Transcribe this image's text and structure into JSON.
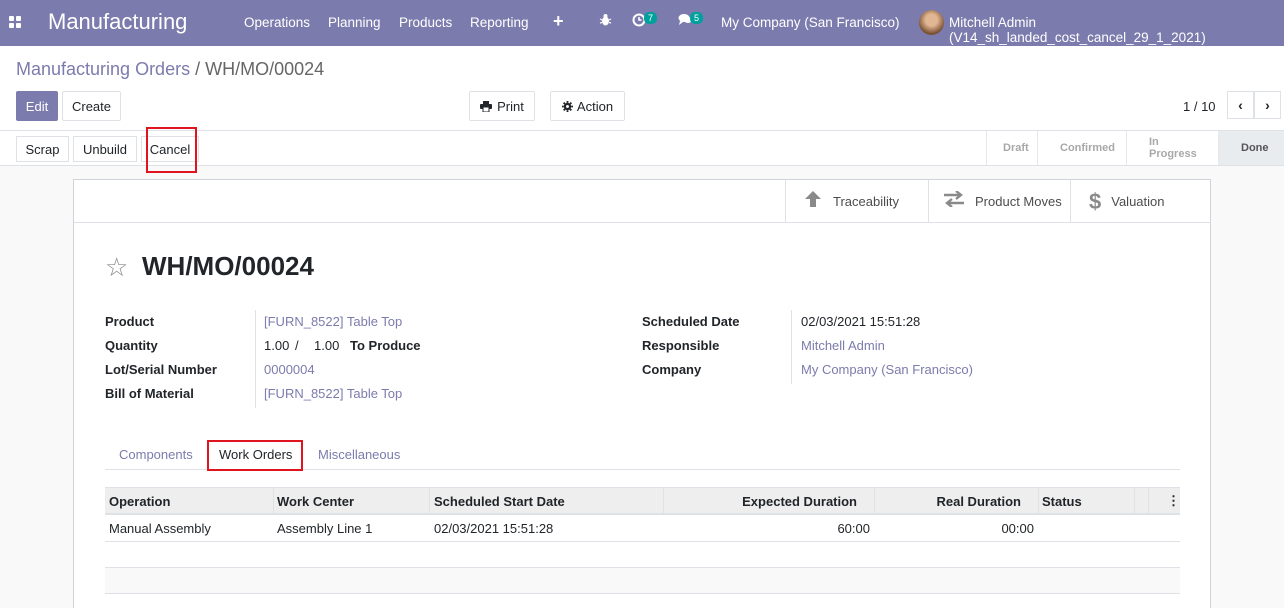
{
  "navbar": {
    "brand": "Manufacturing",
    "menu": [
      "Operations",
      "Planning",
      "Products",
      "Reporting"
    ],
    "activity_count": "7",
    "messages_count": "5",
    "company": "My Company (San Francisco)",
    "user": "Mitchell Admin (V14_sh_landed_cost_cancel_29_1_2021)"
  },
  "breadcrumb": {
    "parent": "Manufacturing Orders",
    "separator": "/",
    "current": "WH/MO/00024"
  },
  "toolbar": {
    "edit": "Edit",
    "create": "Create",
    "print": "Print",
    "action": "Action",
    "pager": "1 / 10"
  },
  "statusbar": {
    "buttons": [
      "Scrap",
      "Unbuild",
      "Cancel"
    ],
    "stages": [
      "Draft",
      "Confirmed",
      "In Progress",
      "Done"
    ],
    "active_stage": "Done"
  },
  "smart_buttons": [
    "Traceability",
    "Product Moves",
    "Valuation"
  ],
  "record": {
    "name": "WH/MO/00024",
    "left_fields": [
      {
        "label": "Product",
        "value": "[FURN_8522] Table Top"
      },
      {
        "label": "Quantity",
        "value": "1.00",
        "value2": "/",
        "value3": "1.00",
        "value4": "To Produce"
      },
      {
        "label": "Lot/Serial Number",
        "value": "0000004"
      },
      {
        "label": "Bill of Material",
        "value": "[FURN_8522] Table Top"
      }
    ],
    "right_fields": [
      {
        "label": "Scheduled Date",
        "value": "02/03/2021 15:51:28"
      },
      {
        "label": "Responsible",
        "value": "Mitchell Admin"
      },
      {
        "label": "Company",
        "value": "My Company (San Francisco)"
      }
    ]
  },
  "tabs": [
    "Components",
    "Work Orders",
    "Miscellaneous"
  ],
  "active_tab": "Work Orders",
  "work_orders": {
    "columns": [
      "Operation",
      "Work Center",
      "Scheduled Start Date",
      "Expected Duration",
      "Real Duration",
      "Status"
    ],
    "rows": [
      [
        "Manual Assembly",
        "Assembly Line 1",
        "02/03/2021 15:51:28",
        "60:00",
        "00:00",
        ""
      ]
    ]
  }
}
